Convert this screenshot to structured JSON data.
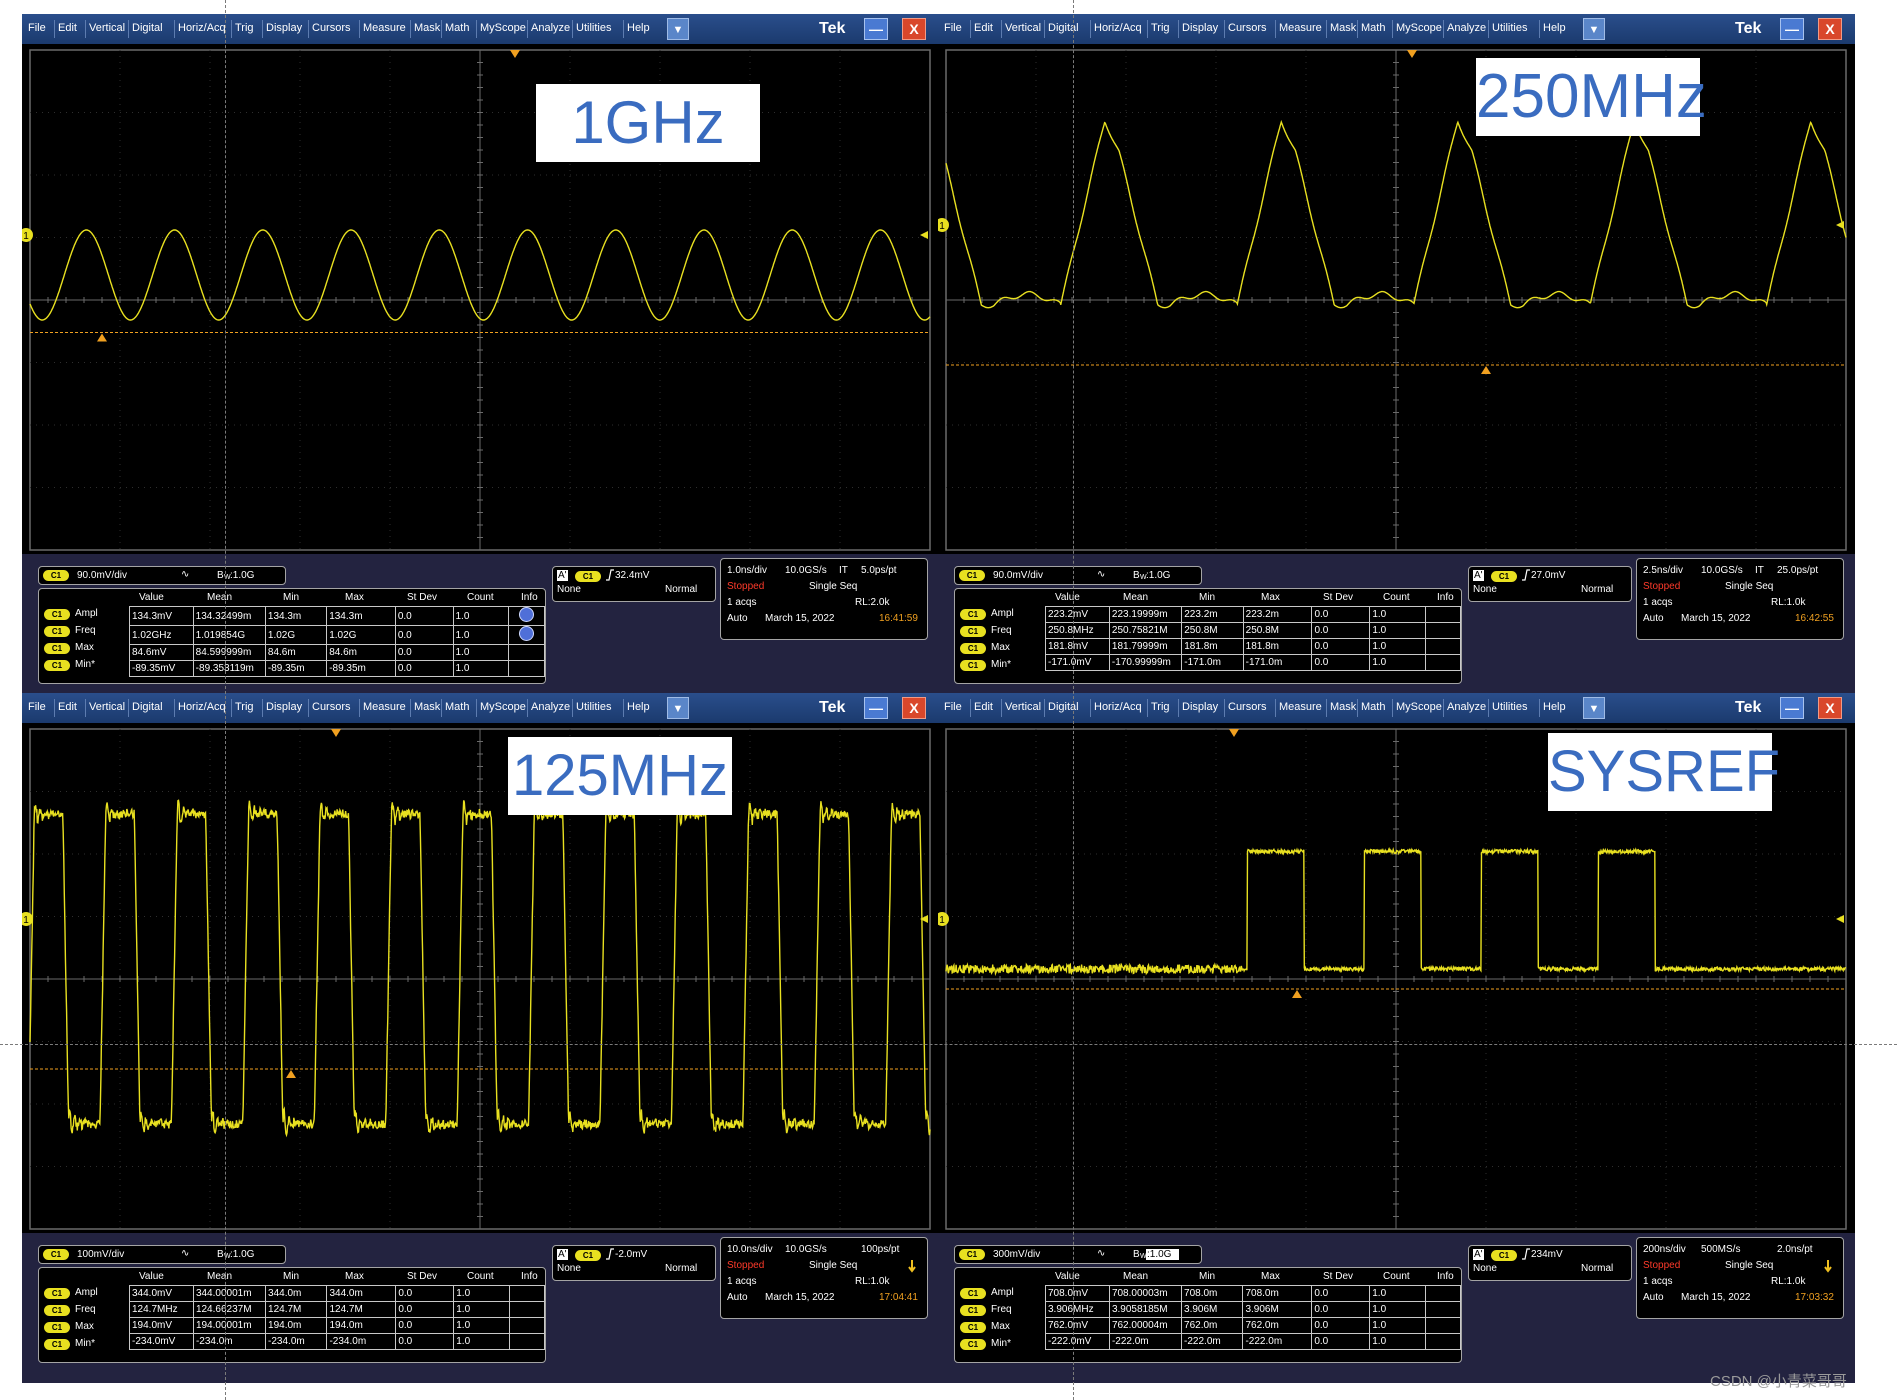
{
  "window": {
    "menu": [
      "File",
      "Edit",
      "Vertical",
      "Digital",
      "Horiz/Acq",
      "Trig",
      "Display",
      "Cursors",
      "Measure",
      "Mask",
      "Math",
      "MyScope",
      "Analyze",
      "Utilities",
      "Help"
    ],
    "dropdown_glyph": "▼",
    "brand": "Tek",
    "minimize": "—",
    "close": "X"
  },
  "measure_headers": [
    "Value",
    "Mean",
    "Min",
    "Max",
    "St Dev",
    "Count",
    "Info"
  ],
  "watermark": "CSDN @小青菜哥哥",
  "colors": {
    "trace": "#e8e020",
    "marker": "#f0a020",
    "grid": "#5a5a5a",
    "screen": "#000000"
  },
  "panels": [
    {
      "overlay_label": "1GHz",
      "waveform_shape": "sine",
      "channel_tag": "C1",
      "channel_scale": "90.0mV/div",
      "coupling_icon": "∿",
      "bandwidth": "B",
      "bandwidth_sub": "W",
      "bandwidth_value": ":1.0G",
      "trigger_tag": "A'",
      "trigger_level": "32.4mV",
      "trigger_source": "None",
      "trigger_mode": "Normal",
      "timebase": "1.0ns/div",
      "sample_rate": "10.0GS/s",
      "mode_it": "IT",
      "res": "5.0ps/pt",
      "run_state": "Stopped",
      "seq": "Single Seq",
      "acqs": "1 acqs",
      "rl": "RL:2.0k",
      "auto": "Auto",
      "date": "March 15, 2022",
      "time": "16:41:59",
      "show_info_icons": true,
      "rows": [
        [
          "Ampl",
          "134.3mV",
          "134.32499m",
          "134.3m",
          "134.3m",
          "0.0",
          "1.0"
        ],
        [
          "Freq",
          "1.02GHz",
          "1.019854G",
          "1.02G",
          "1.02G",
          "0.0",
          "1.0"
        ],
        [
          "Max",
          "84.6mV",
          "84.599999m",
          "84.6m",
          "84.6m",
          "0.0",
          "1.0"
        ],
        [
          "Min*",
          "-89.35mV",
          "-89.353119m",
          "-89.35m",
          "-89.35m",
          "0.0",
          "1.0"
        ]
      ]
    },
    {
      "overlay_label": "250MHz",
      "waveform_shape": "distorted-sine",
      "channel_tag": "C1",
      "channel_scale": "90.0mV/div",
      "coupling_icon": "∿",
      "bandwidth": "B",
      "bandwidth_sub": "W",
      "bandwidth_value": ":1.0G",
      "trigger_tag": "A'",
      "trigger_level": "27.0mV",
      "trigger_source": "None",
      "trigger_mode": "Normal",
      "timebase": "2.5ns/div",
      "sample_rate": "10.0GS/s",
      "mode_it": "IT",
      "res": "25.0ps/pt",
      "run_state": "Stopped",
      "seq": "Single Seq",
      "acqs": "1 acqs",
      "rl": "RL:1.0k",
      "auto": "Auto",
      "date": "March 15, 2022",
      "time": "16:42:55",
      "show_info_icons": false,
      "rows": [
        [
          "Ampl",
          "223.2mV",
          "223.19999m",
          "223.2m",
          "223.2m",
          "0.0",
          "1.0"
        ],
        [
          "Freq",
          "250.8MHz",
          "250.75821M",
          "250.8M",
          "250.8M",
          "0.0",
          "1.0"
        ],
        [
          "Max",
          "181.8mV",
          "181.79999m",
          "181.8m",
          "181.8m",
          "0.0",
          "1.0"
        ],
        [
          "Min*",
          "-171.0mV",
          "-170.99999m",
          "-171.0m",
          "-171.0m",
          "0.0",
          "1.0"
        ]
      ]
    },
    {
      "overlay_label": "125MHz",
      "waveform_shape": "ringing-square",
      "channel_tag": "C1",
      "channel_scale": "100mV/div",
      "coupling_icon": "∿",
      "bandwidth": "B",
      "bandwidth_sub": "W",
      "bandwidth_value": ":1.0G",
      "trigger_tag": "A'",
      "trigger_level": "-2.0mV",
      "trigger_source": "None",
      "trigger_mode": "Normal",
      "timebase": "10.0ns/div",
      "sample_rate": "10.0GS/s",
      "mode_it": "",
      "res": "100ps/pt",
      "run_state": "Stopped",
      "seq": "Single Seq",
      "acqs": "1 acqs",
      "rl": "RL:1.0k",
      "auto": "Auto",
      "date": "March 15, 2022",
      "time": "17:04:41",
      "show_info_icons": false,
      "rows": [
        [
          "Ampl",
          "344.0mV",
          "344.00001m",
          "344.0m",
          "344.0m",
          "0.0",
          "1.0"
        ],
        [
          "Freq",
          "124.7MHz",
          "124.66237M",
          "124.7M",
          "124.7M",
          "0.0",
          "1.0"
        ],
        [
          "Max",
          "194.0mV",
          "194.00001m",
          "194.0m",
          "194.0m",
          "0.0",
          "1.0"
        ],
        [
          "Min*",
          "-234.0mV",
          "-234.0m",
          "-234.0m",
          "-234.0m",
          "0.0",
          "1.0"
        ]
      ]
    },
    {
      "overlay_label": "SYSREF",
      "waveform_shape": "pulse-burst",
      "channel_tag": "C1",
      "channel_scale": "300mV/div",
      "coupling_icon": "∿",
      "bandwidth": "B",
      "bandwidth_sub": "W",
      "bandwidth_value": ":1.0G",
      "trigger_tag": "A'",
      "trigger_level": "234mV",
      "trigger_source": "None",
      "trigger_mode": "Normal",
      "timebase": "200ns/div",
      "sample_rate": "500MS/s",
      "mode_it": "",
      "res": "2.0ns/pt",
      "run_state": "Stopped",
      "seq": "Single Seq",
      "acqs": "1 acqs",
      "rl": "RL:1.0k",
      "auto": "Auto",
      "date": "March 15, 2022",
      "time": "17:03:32",
      "show_info_icons": false,
      "rows": [
        [
          "Ampl",
          "708.0mV",
          "708.00003m",
          "708.0m",
          "708.0m",
          "0.0",
          "1.0"
        ],
        [
          "Freq",
          "3.906MHz",
          "3.9058185M",
          "3.906M",
          "3.906M",
          "0.0",
          "1.0"
        ],
        [
          "Max",
          "762.0mV",
          "762.00004m",
          "762.0m",
          "762.0m",
          "0.0",
          "1.0"
        ],
        [
          "Min*",
          "-222.0mV",
          "-222.0m",
          "-222.0m",
          "-222.0m",
          "0.0",
          "1.0"
        ]
      ]
    }
  ]
}
